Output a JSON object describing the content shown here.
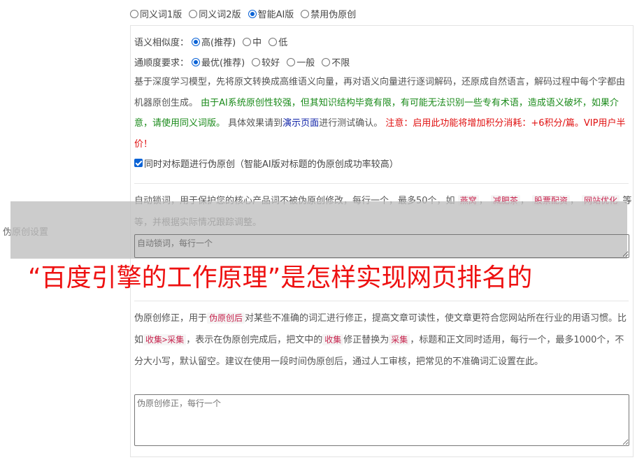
{
  "sidebar_label": "伪原创设置",
  "mode_options": [
    {
      "label": "同义词1版",
      "checked": false
    },
    {
      "label": "同义词2版",
      "checked": false
    },
    {
      "label": "智能AI版",
      "checked": true
    },
    {
      "label": "禁用伪原创",
      "checked": false
    }
  ],
  "similarity": {
    "label": "语义相似度：",
    "options": [
      {
        "label": "高(推荐)",
        "checked": true
      },
      {
        "label": "中",
        "checked": false
      },
      {
        "label": "低",
        "checked": false
      }
    ]
  },
  "fluency": {
    "label": "通顺度要求：",
    "options": [
      {
        "label": "最优(推荐)",
        "checked": true
      },
      {
        "label": "较好",
        "checked": false
      },
      {
        "label": "一般",
        "checked": false
      },
      {
        "label": "不限",
        "checked": false
      }
    ]
  },
  "ai_desc": {
    "part1": "基于深度学习模型，先将原文转换成高维语义向量，再对语义向量进行逐词解码，还原成自然语言，解码过程中每个字都由机器原创生成。",
    "green": "由于AI系统原创性较强，但其知识结构毕竟有限，有可能无法识别一些专有术语，造成语义破坏，如果介意，请使用同义词版。",
    "part2": "具体效果请到",
    "link": "演示页面",
    "part3": "进行测试确认。",
    "red": "注意：启用此功能将增加积分消耗：+6积分/篇。VIP用户半价！"
  },
  "title_checkbox": {
    "label": "同时对标题进行伪原创（智能AI版对标题的伪原创成功率较高）",
    "checked": true
  },
  "lock": {
    "desc_a": "自动锁词，用于保护您的核心产品词不被伪原创修改，每行一个，最多50个，如",
    "tag1": "燕窝",
    "tag2": "减肥茶",
    "tag3": "股票配资",
    "tag4": "网站优化",
    "desc_b": "等等，并根据实际情况跟踪调整。",
    "placeholder": "自动锁词，每行一个"
  },
  "overlay_headline": "“百度引擎的工作原理”是怎样实现网页排名的",
  "fix": {
    "desc_a": "伪原创修正，用于",
    "tag1": "伪原创后",
    "desc_b": "对某些不准确的词汇进行修正，提高文章可读性，使文章更符合您网站所在行业的用语习惯。比如",
    "tag2": "收集>采集",
    "desc_c": "，表示在伪原创完成后，把文中的",
    "tag3": "收集",
    "desc_d": "修正替换为",
    "tag4": "采集",
    "desc_e": "，标题和正文同时适用，每行一个，最多1000个，不分大小写，默认留空。建议在使用一段时间伪原创后，通过人工审核，把常见的不准确词汇设置在此。",
    "placeholder": "伪原创修正，每行一个"
  }
}
